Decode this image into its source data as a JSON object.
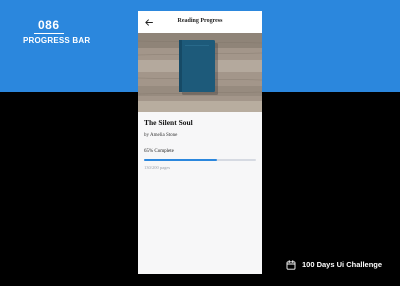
{
  "header": {
    "challenge_number": "086",
    "challenge_title": "PROGRESS BAR"
  },
  "footer": {
    "label": "100 Days Ui Challenge",
    "icon": "calendar-icon"
  },
  "app": {
    "title": "Reading Progress",
    "back_icon": "arrow-left-icon",
    "book": {
      "title": "The Silent Soul",
      "author": "by Amelia Stone"
    },
    "progress": {
      "label": "65% Complete",
      "percent": 65,
      "pages": "130/200 pages"
    }
  },
  "colors": {
    "accent": "#2b87dd",
    "background_top": "#2b87dd",
    "background_bottom": "#000000",
    "track": "#d6dae2",
    "book": "#1d5a7a"
  }
}
